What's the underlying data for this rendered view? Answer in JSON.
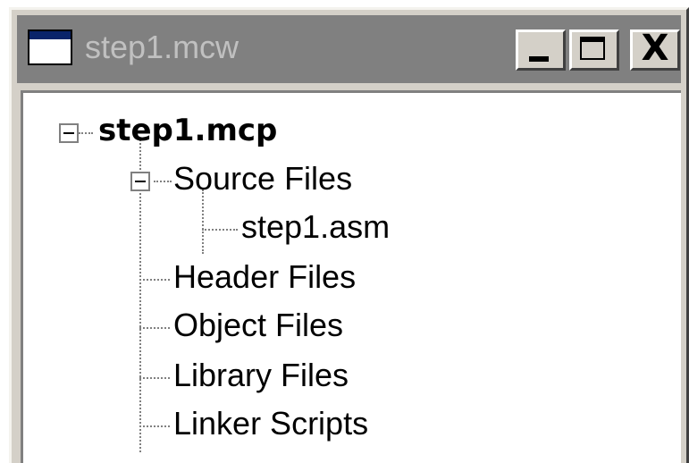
{
  "window": {
    "title": "step1.mcw",
    "icon": "window-icon",
    "controls": {
      "minimize_icon": "minimize-icon",
      "maximize_icon": "maximize-icon",
      "close_icon": "close-icon",
      "close_glyph": "X"
    }
  },
  "tree": {
    "root": {
      "label": "step1.mcp",
      "expanded": true
    },
    "folders": [
      {
        "label": "Source Files",
        "expanded": true,
        "children": [
          "step1.asm"
        ]
      },
      {
        "label": "Header Files"
      },
      {
        "label": "Object Files"
      },
      {
        "label": "Library Files"
      },
      {
        "label": "Linker Scripts"
      }
    ]
  },
  "colors": {
    "inactive_titlebar": "#808080",
    "inactive_title_text": "#c0c0c0",
    "window_face": "#d4d0c8",
    "tree_background": "#ffffff"
  }
}
